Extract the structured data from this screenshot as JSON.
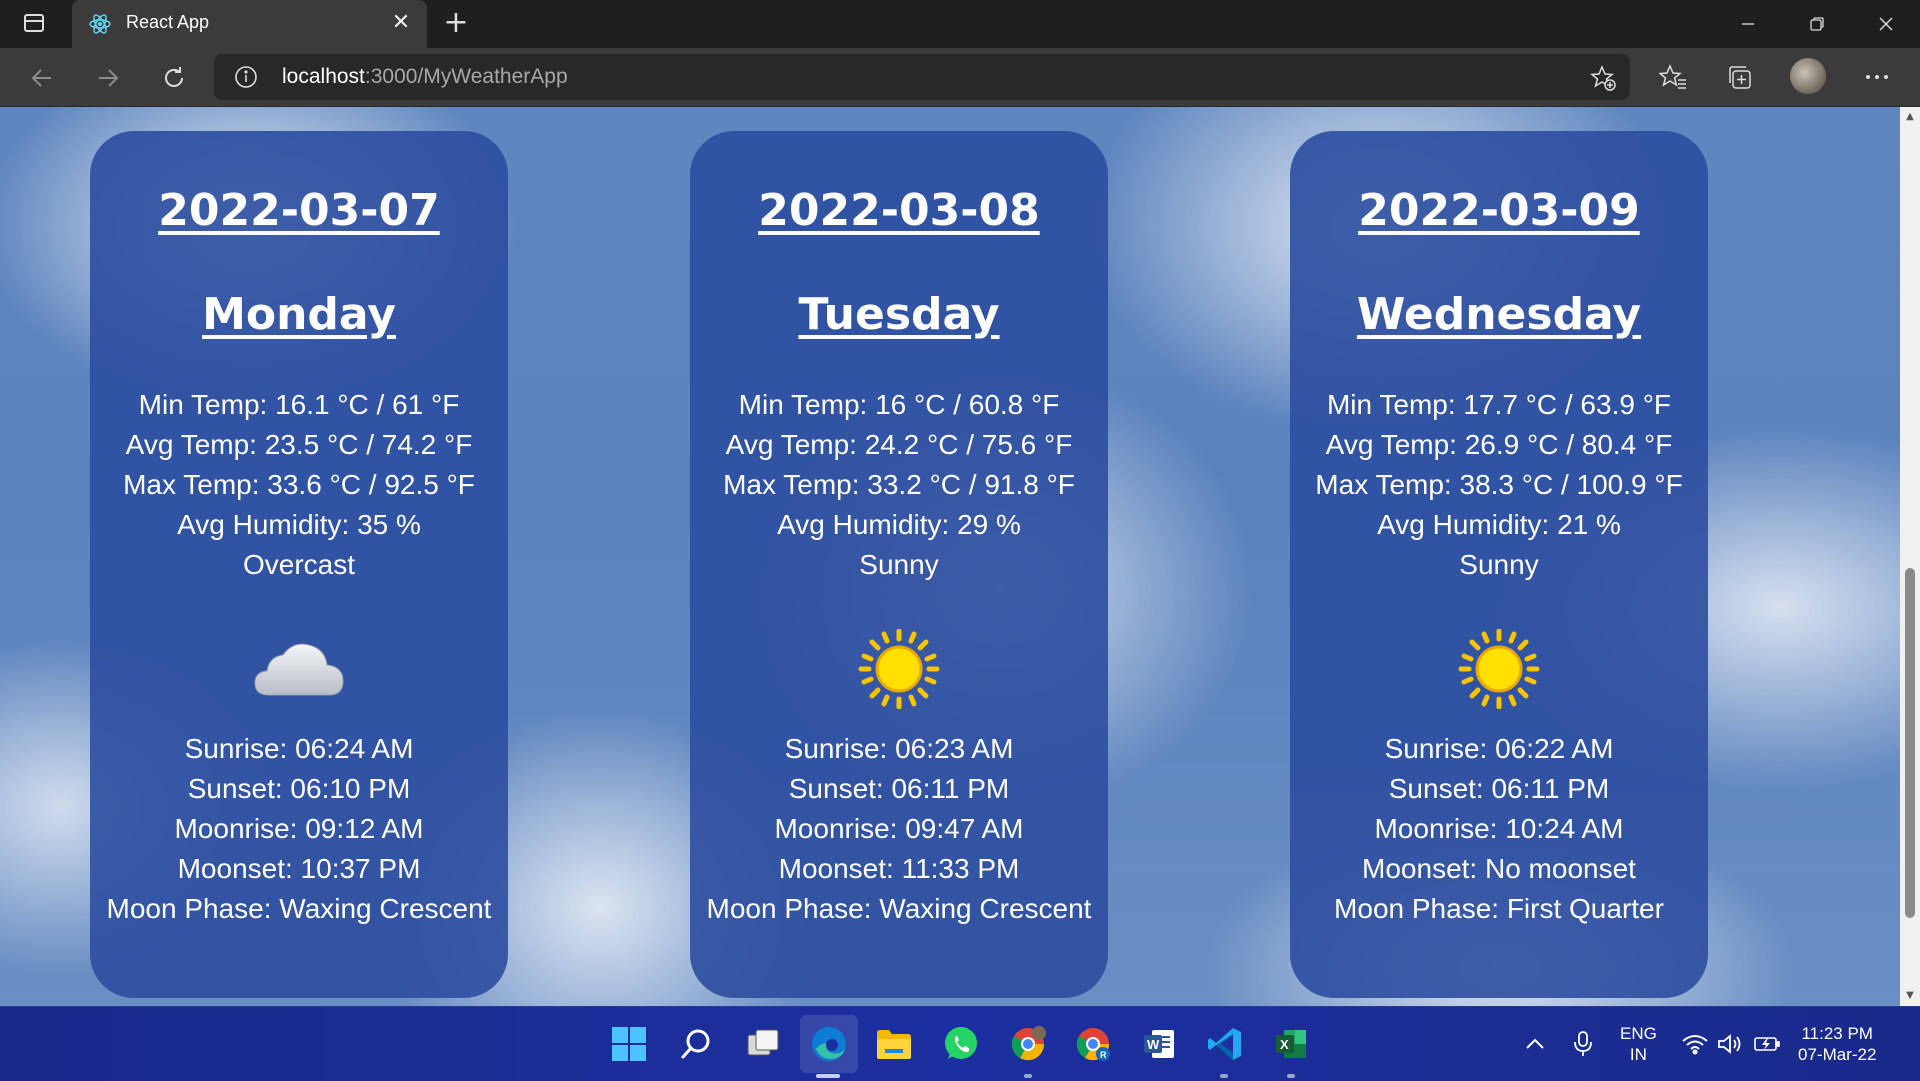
{
  "browser": {
    "tab_title": "React App",
    "url_host": "localhost",
    "url_path": ":3000/MyWeatherApp"
  },
  "forecast": [
    {
      "date": "2022-03-07",
      "day": "Monday",
      "min_temp": "Min Temp: 16.1 °C / 61 °F",
      "avg_temp": "Avg Temp: 23.5 °C / 74.2 °F",
      "max_temp": "Max Temp: 33.6 °C / 92.5 °F",
      "avg_humidity": "Avg Humidity: 35 %",
      "condition": "Overcast",
      "icon": "cloud-icon",
      "sunrise": "Sunrise: 06:24 AM",
      "sunset": "Sunset: 06:10 PM",
      "moonrise": "Moonrise: 09:12 AM",
      "moonset": "Moonset: 10:37 PM",
      "moon_phase": "Moon Phase: Waxing Crescent"
    },
    {
      "date": "2022-03-08",
      "day": "Tuesday",
      "min_temp": "Min Temp: 16 °C / 60.8 °F",
      "avg_temp": "Avg Temp: 24.2 °C / 75.6 °F",
      "max_temp": "Max Temp: 33.2 °C / 91.8 °F",
      "avg_humidity": "Avg Humidity: 29 %",
      "condition": "Sunny",
      "icon": "sun-icon",
      "sunrise": "Sunrise: 06:23 AM",
      "sunset": "Sunset: 06:11 PM",
      "moonrise": "Moonrise: 09:47 AM",
      "moonset": "Moonset: 11:33 PM",
      "moon_phase": "Moon Phase: Waxing Crescent"
    },
    {
      "date": "2022-03-09",
      "day": "Wednesday",
      "min_temp": "Min Temp: 17.7 °C / 63.9 °F",
      "avg_temp": "Avg Temp: 26.9 °C / 80.4 °F",
      "max_temp": "Max Temp: 38.3 °C / 100.9 °F",
      "avg_humidity": "Avg Humidity: 21 %",
      "condition": "Sunny",
      "icon": "sun-icon",
      "sunrise": "Sunrise: 06:22 AM",
      "sunset": "Sunset: 06:11 PM",
      "moonrise": "Moonrise: 10:24 AM",
      "moonset": "Moonset: No moonset",
      "moon_phase": "Moon Phase: First Quarter"
    }
  ],
  "taskbar": {
    "apps": [
      "windows-start-icon",
      "search-icon",
      "task-view-icon",
      "edge-icon",
      "file-explorer-icon",
      "whatsapp-icon",
      "chrome-icon",
      "chrome-profile-icon",
      "word-icon",
      "vscode-icon",
      "excel-icon"
    ],
    "lang_line1": "ENG",
    "lang_line2": "IN",
    "time": "11:23 PM",
    "date": "07-Mar-22"
  },
  "colors": {
    "card_bg": "#2c4ea0",
    "taskbar_bg": "#1c2fa0",
    "titlebar_bg": "#1f1f1f",
    "toolbar_bg": "#3b3b3b"
  }
}
